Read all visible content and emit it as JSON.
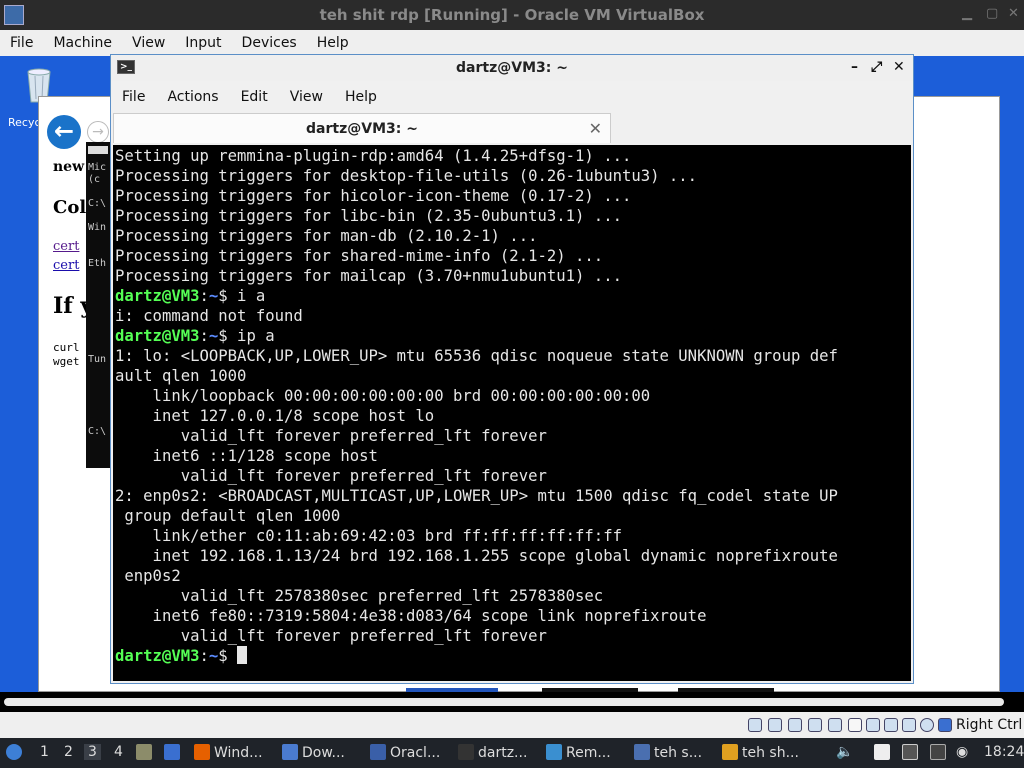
{
  "vbox": {
    "title": "teh shit rdp [Running] - Oracle VM VirtualBox",
    "menu": [
      "File",
      "Machine",
      "View",
      "Input",
      "Devices",
      "Help"
    ],
    "host_key": "Right Ctrl"
  },
  "guest": {
    "recycle_label": "Recyc",
    "page_lines": [
      "new",
      "Col",
      "cert",
      "cert",
      "If y",
      "curl",
      "wget"
    ],
    "cmd_lines": [
      "Mic",
      "(c",
      "C:\\",
      "Win",
      "Eth",
      "Tun",
      "C:\\"
    ]
  },
  "terminal": {
    "title": "dartz@VM3: ~",
    "tab_title": "dartz@VM3: ~",
    "menu": [
      "File",
      "Actions",
      "Edit",
      "View",
      "Help"
    ],
    "lines": [
      {
        "text": "Setting up remmina-plugin-rdp:amd64 (1.4.25+dfsg-1) ..."
      },
      {
        "text": "Processing triggers for desktop-file-utils (0.26-1ubuntu3) ..."
      },
      {
        "text": "Processing triggers for hicolor-icon-theme (0.17-2) ..."
      },
      {
        "text": "Processing triggers for libc-bin (2.35-0ubuntu3.1) ..."
      },
      {
        "text": "Processing triggers for man-db (2.10.2-1) ..."
      },
      {
        "text": "Processing triggers for shared-mime-info (2.1-2) ..."
      },
      {
        "text": "Processing triggers for mailcap (3.70+nmu1ubuntu1) ..."
      },
      {
        "user": "dartz@VM3",
        "path": "~",
        "cmd": "$ i a"
      },
      {
        "text": "i: command not found"
      },
      {
        "user": "dartz@VM3",
        "path": "~",
        "cmd": "$ ip a"
      },
      {
        "text": "1: lo: <LOOPBACK,UP,LOWER_UP> mtu 65536 qdisc noqueue state UNKNOWN group def"
      },
      {
        "text": "ault qlen 1000"
      },
      {
        "text": "    link/loopback 00:00:00:00:00:00 brd 00:00:00:00:00:00"
      },
      {
        "text": "    inet 127.0.0.1/8 scope host lo"
      },
      {
        "text": "       valid_lft forever preferred_lft forever"
      },
      {
        "text": "    inet6 ::1/128 scope host"
      },
      {
        "text": "       valid_lft forever preferred_lft forever"
      },
      {
        "text": "2: enp0s2: <BROADCAST,MULTICAST,UP,LOWER_UP> mtu 1500 qdisc fq_codel state UP"
      },
      {
        "text": " group default qlen 1000"
      },
      {
        "text": "    link/ether c0:11:ab:69:42:03 brd ff:ff:ff:ff:ff:ff"
      },
      {
        "text": "    inet 192.168.1.13/24 brd 192.168.1.255 scope global dynamic noprefixroute"
      },
      {
        "text": " enp0s2"
      },
      {
        "text": "       valid_lft 2578380sec preferred_lft 2578380sec"
      },
      {
        "text": "    inet6 fe80::7319:5804:4e38:d083/64 scope link noprefixroute"
      },
      {
        "text": "       valid_lft forever preferred_lft forever"
      },
      {
        "user": "dartz@VM3",
        "path": "~",
        "cmd": "$ ",
        "cursor": true
      }
    ]
  },
  "taskbar": {
    "workspaces": [
      "1",
      "2",
      "3",
      "4"
    ],
    "active_workspace": "3",
    "items": [
      {
        "label": "Wind...",
        "icon": "firefox-icon",
        "color": "#e66000"
      },
      {
        "label": "Dow...",
        "icon": "folder-icon",
        "color": "#4a7bd0"
      },
      {
        "label": "Oracl...",
        "icon": "virtualbox-icon",
        "color": "#3a5fa8"
      },
      {
        "label": "dartz...",
        "icon": "terminal-icon",
        "color": "#333333"
      },
      {
        "label": "Rem...",
        "icon": "remmina-icon",
        "color": "#3a8fd0"
      },
      {
        "label": "teh s...",
        "icon": "windows-server-icon",
        "color": "#4a6fb0"
      },
      {
        "label": "teh sh...",
        "icon": "gear-icon",
        "color": "#e0a020"
      }
    ],
    "clock": "18:24"
  },
  "colors": {
    "prompt_user": "#55ff55",
    "prompt_path": "#5c8cff",
    "terminal_bg": "#000000",
    "guest_desktop": "#1c5ed9"
  }
}
